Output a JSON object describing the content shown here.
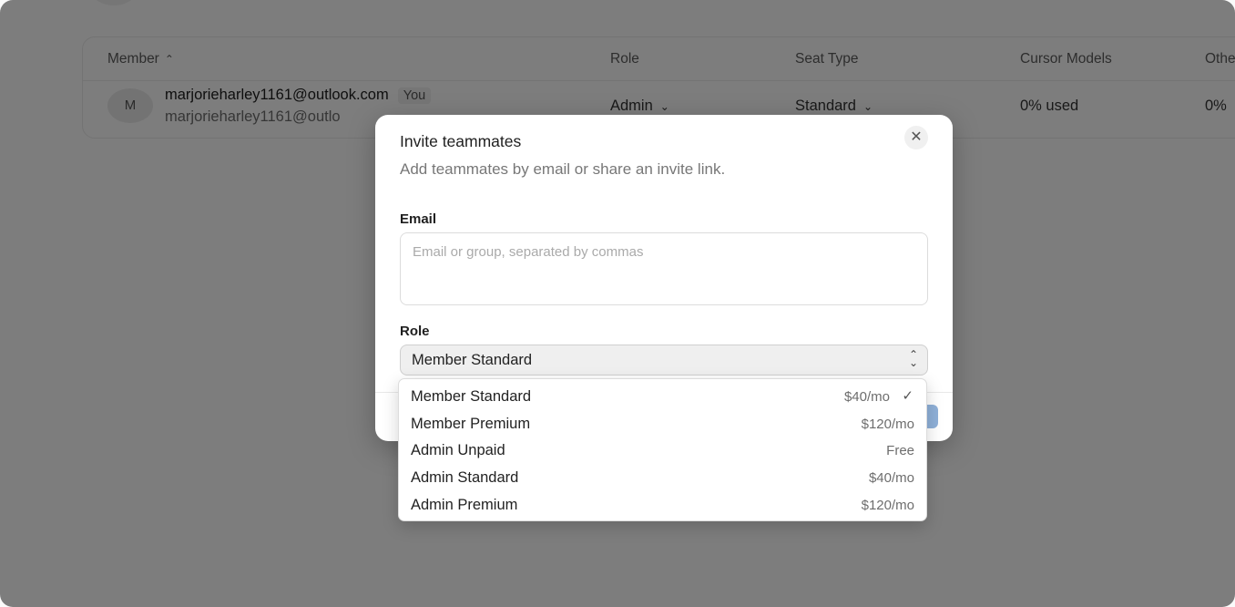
{
  "table": {
    "columns": {
      "member": "Member",
      "role": "Role",
      "seat_type": "Seat Type",
      "cursor_models": "Cursor Models",
      "other": "Othe"
    },
    "rows": [
      {
        "avatar_initial": "M",
        "email": "marjorieharley1161@outlook.com",
        "badge": "You",
        "sub_email": "marjorieharley1161@outlo",
        "role": "Admin",
        "seat_type": "Standard",
        "cursor_models": "0% used",
        "other": "0%"
      }
    ]
  },
  "modal": {
    "title": "Invite teammates",
    "subtitle": "Add teammates by email or share an invite link.",
    "email_label": "Email",
    "email_placeholder": "Email or group, separated by commas",
    "role_label": "Role",
    "role_selected": "Member Standard",
    "close_glyph": "✕"
  },
  "role_options": [
    {
      "label": "Member Standard",
      "price": "$40/mo",
      "selected": true
    },
    {
      "label": "Member Premium",
      "price": "$120/mo",
      "selected": false
    },
    {
      "label": "Admin Unpaid",
      "price": "Free",
      "selected": false
    },
    {
      "label": "Admin Standard",
      "price": "$40/mo",
      "selected": false
    },
    {
      "label": "Admin Premium",
      "price": "$120/mo",
      "selected": false
    }
  ],
  "icons": {
    "sort_up": "⌃",
    "chevron_down": "⌄",
    "check": "✓"
  },
  "colors": {
    "overlay": "rgba(0,0,0,0.5)",
    "primary_button": "#8fb0d8"
  }
}
